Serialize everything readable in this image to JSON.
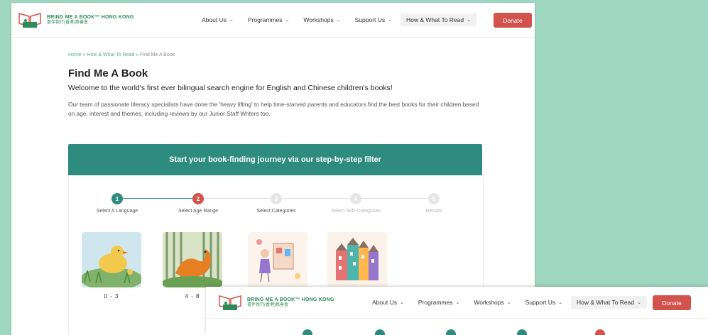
{
  "brand": {
    "name_en": "BRING ME A BOOK™ HONG KONG",
    "name_zh": "書伴我行(香港)慈善會"
  },
  "nav": {
    "items": [
      {
        "label": "About Us",
        "active": false
      },
      {
        "label": "Programmes",
        "active": false
      },
      {
        "label": "Workshops",
        "active": false
      },
      {
        "label": "Support Us",
        "active": false
      },
      {
        "label": "How & What To Read",
        "active": true
      }
    ],
    "donate_label": "Donate"
  },
  "breadcrumb": {
    "home": "Home",
    "section": "How & What To Read",
    "current": "Find Me A Book",
    "separator": "»"
  },
  "page": {
    "title": "Find Me A Book",
    "subtitle": "Welcome to the world's first ever bilingual search engine for English and Chinese children's books!",
    "description": "Our team of passionate literacy specialists have done the 'heavy lifting' to help time-starved parents and educators find the best books for their children based on age, interest and themes, including reviews by our Junior Staff Writers too."
  },
  "filter": {
    "banner": "Start your book-finding journey via our step-by-step filter",
    "steps": [
      {
        "number": "1",
        "label": "Select A Language",
        "state": "done"
      },
      {
        "number": "2",
        "label": "Select Age Range",
        "state": "current"
      },
      {
        "number": "3",
        "label": "Select Categories",
        "state": "upcoming"
      },
      {
        "number": "4",
        "label": "Select Sub-Categories",
        "state": "disabled"
      },
      {
        "number": "5",
        "label": "Results",
        "state": "disabled"
      }
    ],
    "age_ranges": [
      {
        "label": "0 - 3",
        "icon": "duck-illustration-icon"
      },
      {
        "label": "4 - 8",
        "icon": "dragon-illustration-icon"
      },
      {
        "label": "",
        "icon": "girl-with-book-illustration-icon"
      },
      {
        "label": "",
        "icon": "houses-illustration-icon"
      }
    ]
  },
  "colors": {
    "teal": "#2e8b7f",
    "red": "#d2534b",
    "background": "#9fd6c2"
  }
}
